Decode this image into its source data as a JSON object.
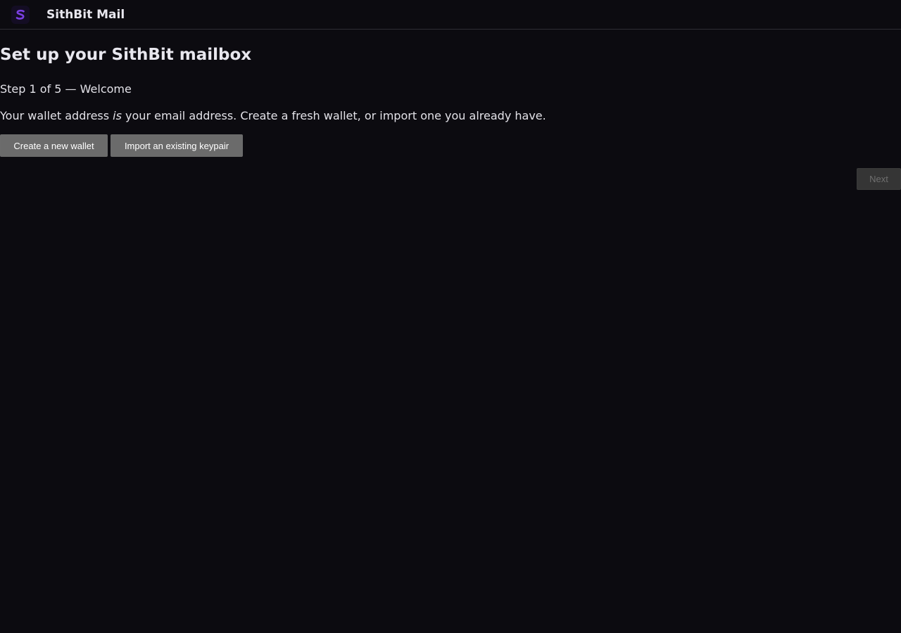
{
  "header": {
    "app_title": "SithBit Mail",
    "logo_letter": "S",
    "logo_icon": "sithbit-logo-icon",
    "accent_color": "#7b3fe4"
  },
  "main": {
    "title": "Set up your SithBit mailbox",
    "step_text": "Step 1 of 5 — Welcome",
    "intro_before": "Your wallet address ",
    "intro_emphasis": "is",
    "intro_after": " your email address. Create a fresh wallet, or import one you already have.",
    "create_wallet_label": "Create a new wallet",
    "import_keypair_label": "Import an existing keypair",
    "next_label": "Next",
    "next_disabled": true
  }
}
